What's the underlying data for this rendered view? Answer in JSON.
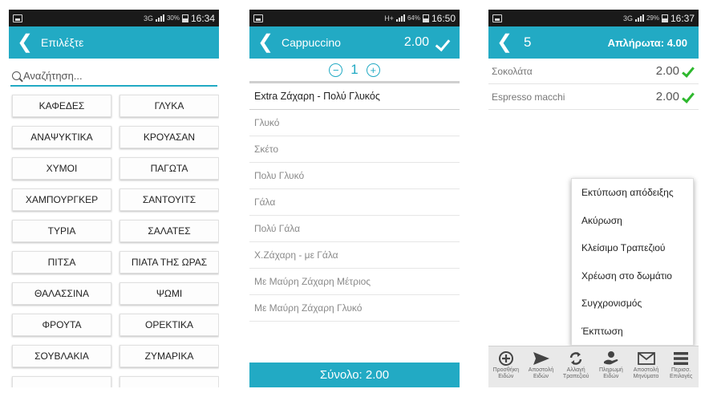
{
  "status_bars": [
    {
      "signal": "3G",
      "battery": "30%",
      "time": "16:34"
    },
    {
      "signal": "H+",
      "battery": "64%",
      "time": "16:50"
    },
    {
      "signal": "3G",
      "battery": "29%",
      "time": "16:37"
    }
  ],
  "panel1": {
    "title": "Επιλέξτε",
    "search_placeholder": "Αναζήτηση...",
    "categories": [
      "ΚΑΦΕΔΕΣ",
      "ΓΛΥΚΑ",
      "ΑΝΑΨΥΚΤΙΚΑ",
      "ΚΡΟΥΑΣΑΝ",
      "ΧΥΜΟΙ",
      "ΠΑΓΩΤΑ",
      "ΧΑΜΠΟΥΡΓΚΕΡ",
      "ΣΑΝΤΟΥΙΤΣ",
      "ΤΥΡΙΑ",
      "ΣΑΛΑΤΕΣ",
      "ΠΙΤΣΑ",
      "ΠΙΑΤΑ ΤΗΣ ΩΡΑΣ",
      "ΘΑΛΑΣΣΙΝΑ",
      "ΨΩΜΙ",
      "ΦΡΟΥΤΑ",
      "ΟΡΕΚΤΙΚΑ",
      "ΣΟΥΒΛΑΚΙΑ",
      "ΖΥΜΑΡΙΚΑ"
    ]
  },
  "panel2": {
    "title": "Cappuccino",
    "price": "2.00",
    "quantity": "1",
    "selected_option": "Extra Ζάχαρη - Πολύ Γλυκός",
    "options": [
      "Γλυκό",
      "Σκέτο",
      "Πολυ Γλυκό",
      "Γάλα",
      "Πολύ Γάλα",
      "Χ.Ζάχαρη - με Γάλα",
      "Με Μαύρη Ζάχαρη Μέτριος",
      "Με Μαύρη Ζάχαρη Γλυκό"
    ],
    "total": "Σύνολο: 2.00"
  },
  "panel3": {
    "table_number": "5",
    "unpaid": "Απλήρωτα: 4.00",
    "orders": [
      {
        "name": "Σοκολάτα",
        "amount": "2.00"
      },
      {
        "name": "Espresso macchi",
        "amount": "2.00"
      }
    ],
    "menu": [
      "Εκτύπωση απόδειξης",
      "Ακύρωση",
      "Κλείσιμο Τραπεζιού",
      "Χρέωση στο δωμάτιο",
      "Συγχρονισμός",
      "Έκπτωση"
    ],
    "toolbar": [
      {
        "label": "Προσθήκη Ειδών",
        "icon": "plus-circle-icon"
      },
      {
        "label": "Αποστολή Ειδών",
        "icon": "send-icon"
      },
      {
        "label": "Αλλαγή Τραπεζιού",
        "icon": "swap-icon"
      },
      {
        "label": "Πληρωμή Ειδών",
        "icon": "payment-icon"
      },
      {
        "label": "Αποστολή Μηνύματο",
        "icon": "envelope-icon"
      },
      {
        "label": "Περισσ. Επιλογές",
        "icon": "menu-icon"
      }
    ]
  },
  "colors": {
    "accent": "#22aac4",
    "check_green": "#2eb82e"
  }
}
